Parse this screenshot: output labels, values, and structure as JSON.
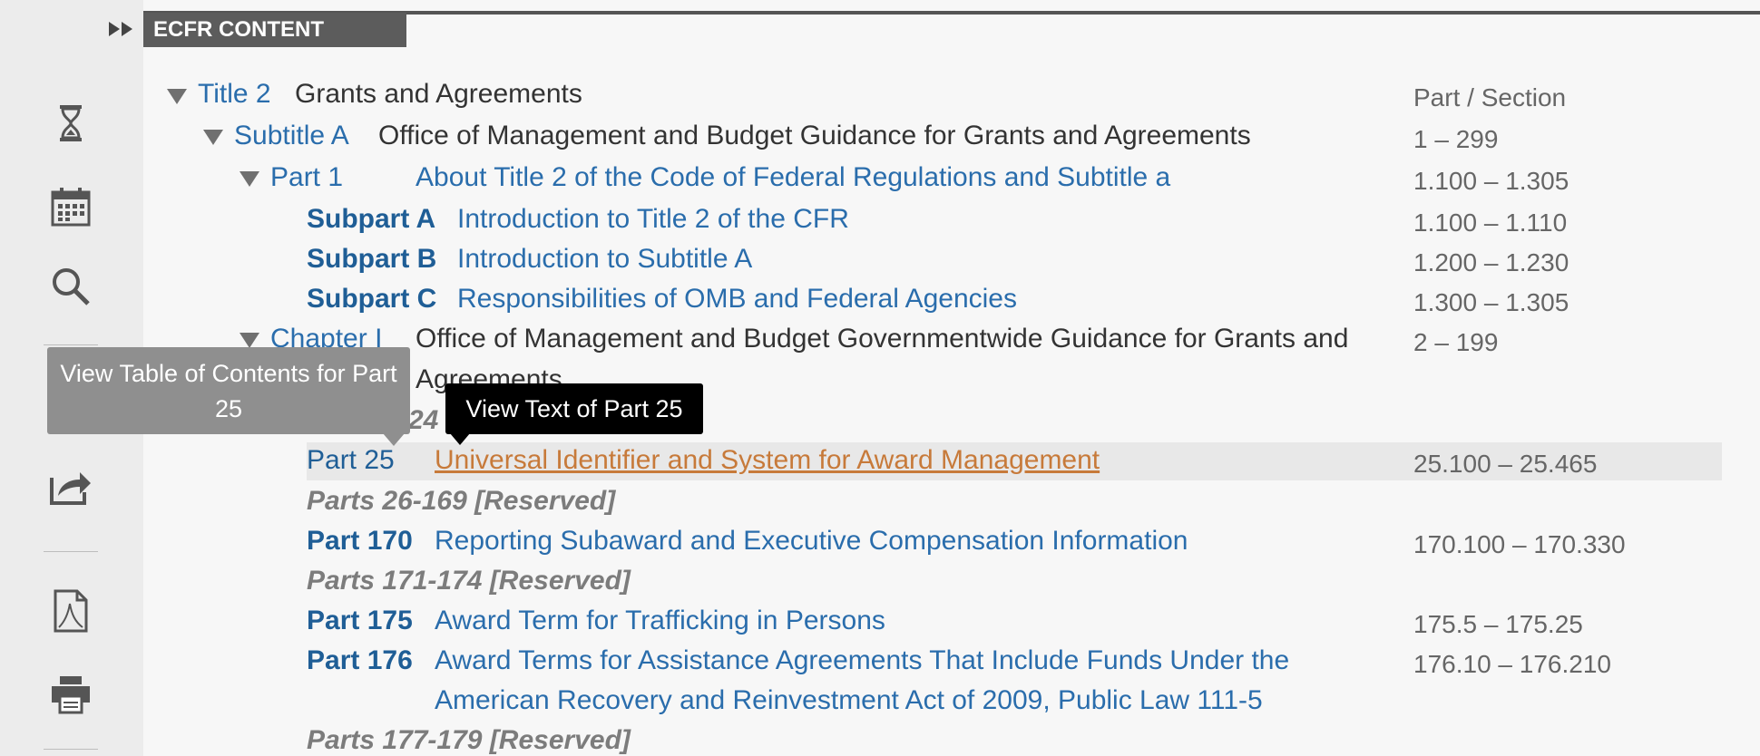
{
  "tab": {
    "label": "ECFR CONTENT"
  },
  "rail": {
    "icons": [
      "expand-icon",
      "hourglass-icon",
      "calendar-icon",
      "search-icon",
      "share-icon",
      "pdf-icon",
      "print-icon"
    ]
  },
  "header": {
    "column_label": "Part / Section"
  },
  "toc": {
    "title": {
      "label": "Title 2",
      "text": "Grants and Agreements"
    },
    "subtitle": {
      "label": "Subtitle A",
      "text": "Office of Management and Budget Guidance for Grants and Agreements",
      "range": "1 – 299"
    },
    "part1": {
      "label": "Part 1",
      "text": "About Title 2 of the Code of Federal Regulations and Subtitle a",
      "range": "1.100 – 1.305"
    },
    "subparts": [
      {
        "label": "Subpart A",
        "text": "Introduction to Title 2 of the CFR",
        "range": "1.100 – 1.110"
      },
      {
        "label": "Subpart B",
        "text": "Introduction to Subtitle A",
        "range": "1.200 – 1.230"
      },
      {
        "label": "Subpart C",
        "text": "Responsibilities of OMB and Federal Agencies",
        "range": "1.300 – 1.305"
      }
    ],
    "chapter": {
      "label": "Chapter I",
      "text_line1": "Office of Management and Budget Governmentwide Guidance for Grants and",
      "text_line2": "Agreements",
      "range": "2 – 199"
    },
    "partial_reserved": "24",
    "part25": {
      "label": "Part 25",
      "text": "Universal Identifier and System for Award Management",
      "range": "25.100 – 25.465"
    },
    "reserved_26": "Parts 26-169 [Reserved]",
    "part170": {
      "label": "Part 170",
      "text": "Reporting Subaward and Executive Compensation Information",
      "range": "170.100 – 170.330"
    },
    "reserved_171": "Parts 171-174 [Reserved]",
    "part175": {
      "label": "Part 175",
      "text": "Award Term for Trafficking in Persons",
      "range": "175.5 – 175.25"
    },
    "part176": {
      "label": "Part 176",
      "text_line1": "Award Terms for Assistance Agreements That Include Funds Under the",
      "text_line2": "American Recovery and Reinvestment Act of 2009, Public Law 111-5",
      "range": "176.10 – 176.210"
    },
    "reserved_177": "Parts 177-179 [Reserved]"
  },
  "tooltips": {
    "toc": "View Table of Contents for Part 25",
    "text": "View Text of Part 25"
  }
}
